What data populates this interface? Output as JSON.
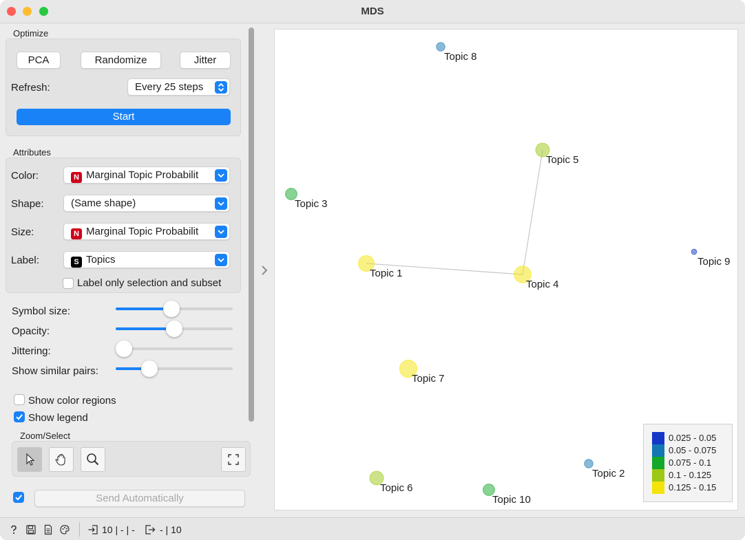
{
  "window": {
    "title": "MDS"
  },
  "optimize": {
    "section_label": "Optimize",
    "pca_label": "PCA",
    "randomize_label": "Randomize",
    "jitter_label": "Jitter",
    "refresh_label": "Refresh:",
    "refresh_value": "Every 25 steps",
    "start_label": "Start"
  },
  "attributes": {
    "section_label": "Attributes",
    "color_label": "Color:",
    "color_value": "Marginal Topic Probabilit",
    "shape_label": "Shape:",
    "shape_value": "(Same shape)",
    "size_label": "Size:",
    "size_value": "Marginal Topic Probabilit",
    "label_label": "Label:",
    "label_value": "Topics",
    "label_only_selection": "Label only selection and subset",
    "label_only_selection_checked": false
  },
  "sliders": {
    "symbol_size_label": "Symbol size:",
    "symbol_size_value": 0.48,
    "opacity_label": "Opacity:",
    "opacity_value": 0.5,
    "jittering_label": "Jittering:",
    "jittering_value": 0.07,
    "similar_pairs_label": "Show similar pairs:",
    "similar_pairs_value": 0.29
  },
  "options": {
    "color_regions_label": "Show color regions",
    "color_regions_checked": false,
    "legend_label": "Show legend",
    "legend_checked": true
  },
  "zoom_select": {
    "section_label": "Zoom/Select",
    "tools": [
      "pointer-icon",
      "hand-pan-icon",
      "zoom-icon",
      "fit-to-view-icon"
    ]
  },
  "send": {
    "auto_checked": true,
    "label": "Send Automatically"
  },
  "plot": {
    "points": [
      {
        "label": "Topic 8",
        "value": 0.06
      },
      {
        "label": "Topic 5",
        "value": 0.11
      },
      {
        "label": "Topic 3",
        "value": 0.09
      },
      {
        "label": "Topic 9",
        "value": 0.03
      },
      {
        "label": "Topic 1",
        "value": 0.13
      },
      {
        "label": "Topic 4",
        "value": 0.14
      },
      {
        "label": "Topic 7",
        "value": 0.145
      },
      {
        "label": "Topic 2",
        "value": 0.06
      },
      {
        "label": "Topic 6",
        "value": 0.11
      },
      {
        "label": "Topic 10",
        "value": 0.09
      }
    ],
    "similar_pairs": [
      [
        "Topic 1",
        "Topic 4"
      ],
      [
        "Topic 4",
        "Topic 5"
      ]
    ],
    "legend": [
      {
        "range": "0.025 - 0.05",
        "color": "#1437c8"
      },
      {
        "range": "0.05 - 0.075",
        "color": "#1477b4"
      },
      {
        "range": "0.075 - 0.1",
        "color": "#14a82a"
      },
      {
        "range": "0.1 - 0.125",
        "color": "#9dc814"
      },
      {
        "range": "0.125 - 0.15",
        "color": "#f5e40a"
      }
    ]
  },
  "status": {
    "input_summary": "10 | - | -",
    "output_summary": "- | 10"
  }
}
